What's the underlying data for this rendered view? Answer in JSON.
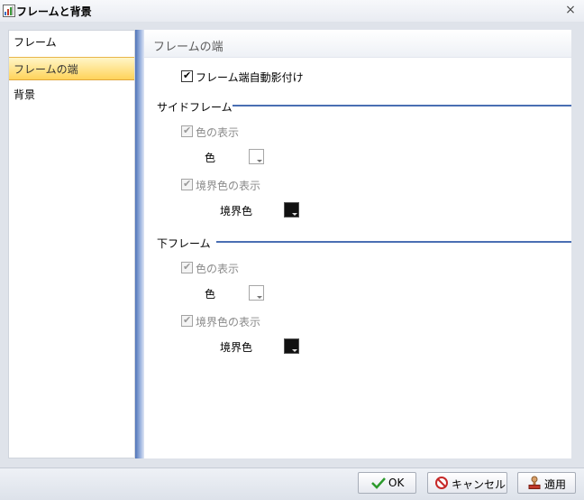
{
  "window": {
    "title": "フレームと背景",
    "close_symbol": "×"
  },
  "sidebar": {
    "items": [
      {
        "label": "フレーム"
      },
      {
        "label": "フレームの端"
      },
      {
        "label": "背景"
      }
    ],
    "selected_index": 1
  },
  "panel": {
    "title": "フレームの端",
    "auto_shadow": {
      "label": "フレーム端自動影付け",
      "checked": true
    },
    "side_frame": {
      "heading": "サイドフレーム",
      "show_color": {
        "label": "色の表示",
        "checked": true,
        "enabled": false
      },
      "color_label": "色",
      "color_value": "#ffffff",
      "show_border_color": {
        "label": "境界色の表示",
        "checked": true,
        "enabled": false
      },
      "border_color_label": "境界色",
      "border_color_value": "#000000"
    },
    "bottom_frame": {
      "heading": "下フレーム",
      "show_color": {
        "label": "色の表示",
        "checked": true,
        "enabled": false
      },
      "color_label": "色",
      "color_value": "#ffffff",
      "show_border_color": {
        "label": "境界色の表示",
        "checked": true,
        "enabled": false
      },
      "border_color_label": "境界色",
      "border_color_value": "#000000"
    }
  },
  "buttons": {
    "ok": "OK",
    "cancel": "キャンセル",
    "apply": "適用"
  },
  "colors": {
    "accent_line": "#4a6fb3",
    "selected_item": "#ffd35a"
  },
  "icons": {
    "app": "chart-window-icon",
    "ok": "checkmark-icon",
    "cancel": "cancel-circle-icon",
    "apply": "stamp-icon"
  }
}
